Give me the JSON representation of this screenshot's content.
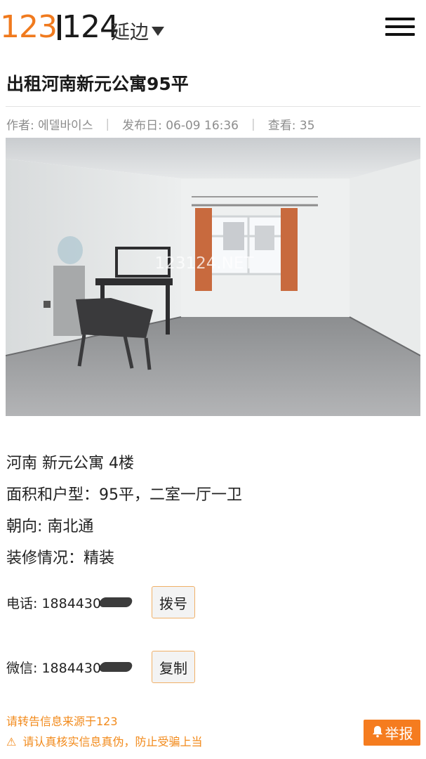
{
  "header": {
    "logo": {
      "part1": "123",
      "part2": "124"
    },
    "city": "延边",
    "menu_icon": "hamburger-menu-icon"
  },
  "listing": {
    "title": "出租河南新元公寓95平",
    "meta": {
      "author": "作者: 에델바이스",
      "date": "发布日: 06-09 16:36",
      "views": "查看: 35"
    },
    "photo_watermark": "123124.NET",
    "details": [
      "河南 新元公寓 4楼",
      "面积和户型：95平，二室一厅一卫",
      "朝向: 南北通",
      "装修情况：精装"
    ]
  },
  "contact": {
    "phone_label": "电话: 1884430",
    "dial_button": "拨号",
    "wechat_label": "微信: 1884430",
    "copy_button": "复制"
  },
  "notices": {
    "source": "请转告信息来源于123",
    "warning": "请认真核实信息真伪，防止受骗上当",
    "warning_icon": "warning-triangle-icon"
  },
  "report_button": {
    "label": "举报",
    "icon": "bell-icon"
  },
  "colors": {
    "accent": "#f57c1f",
    "logo_orange": "#f07a1e",
    "notice": "#f28a1b"
  }
}
